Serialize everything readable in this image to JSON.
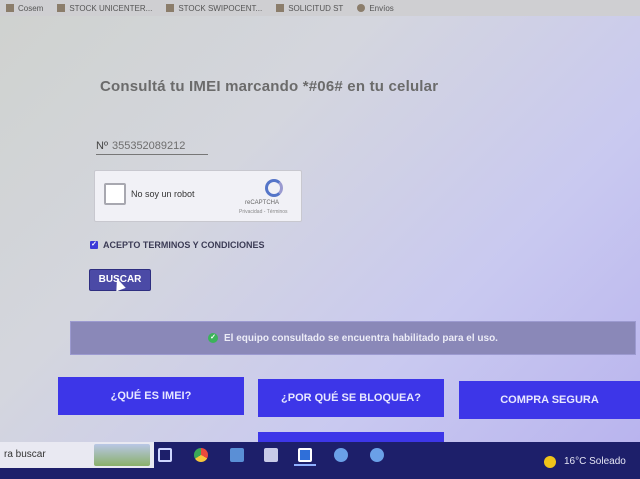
{
  "bookmarks": [
    {
      "label": "Cosem",
      "icon": "folder-icon"
    },
    {
      "label": "STOCK UNICENTER...",
      "icon": "folder-icon"
    },
    {
      "label": "STOCK SWIPOCENT...",
      "icon": "folder-icon"
    },
    {
      "label": "SOLICITUD ST",
      "icon": "folder-icon"
    },
    {
      "label": "Envíos",
      "icon": "drop-icon"
    }
  ],
  "page": {
    "title": "Consultá tu IMEI marcando *#06# en tu celular",
    "imei": {
      "prefix": "Nº",
      "value": "355352089212"
    },
    "captcha": {
      "label": "No soy un robot",
      "brand": "reCAPTCHA",
      "links": "Privacidad - Términos"
    },
    "terms_label": "ACEPTO TERMINOS Y CONDICIONES",
    "search_button": "BUSCAR",
    "status_message": "El equipo consultado se encuentra habilitado para el uso.",
    "buttons": [
      "¿QUÉ ES IMEI?",
      "¿POR QUÉ SE BLOQUEA?",
      "COMPRA SEGURA"
    ]
  },
  "taskbar": {
    "search_placeholder": "ra buscar",
    "weather": "16°C  Soleado"
  },
  "colors": {
    "accent": "#3d36e8",
    "status_ok": "#3bb35a"
  }
}
